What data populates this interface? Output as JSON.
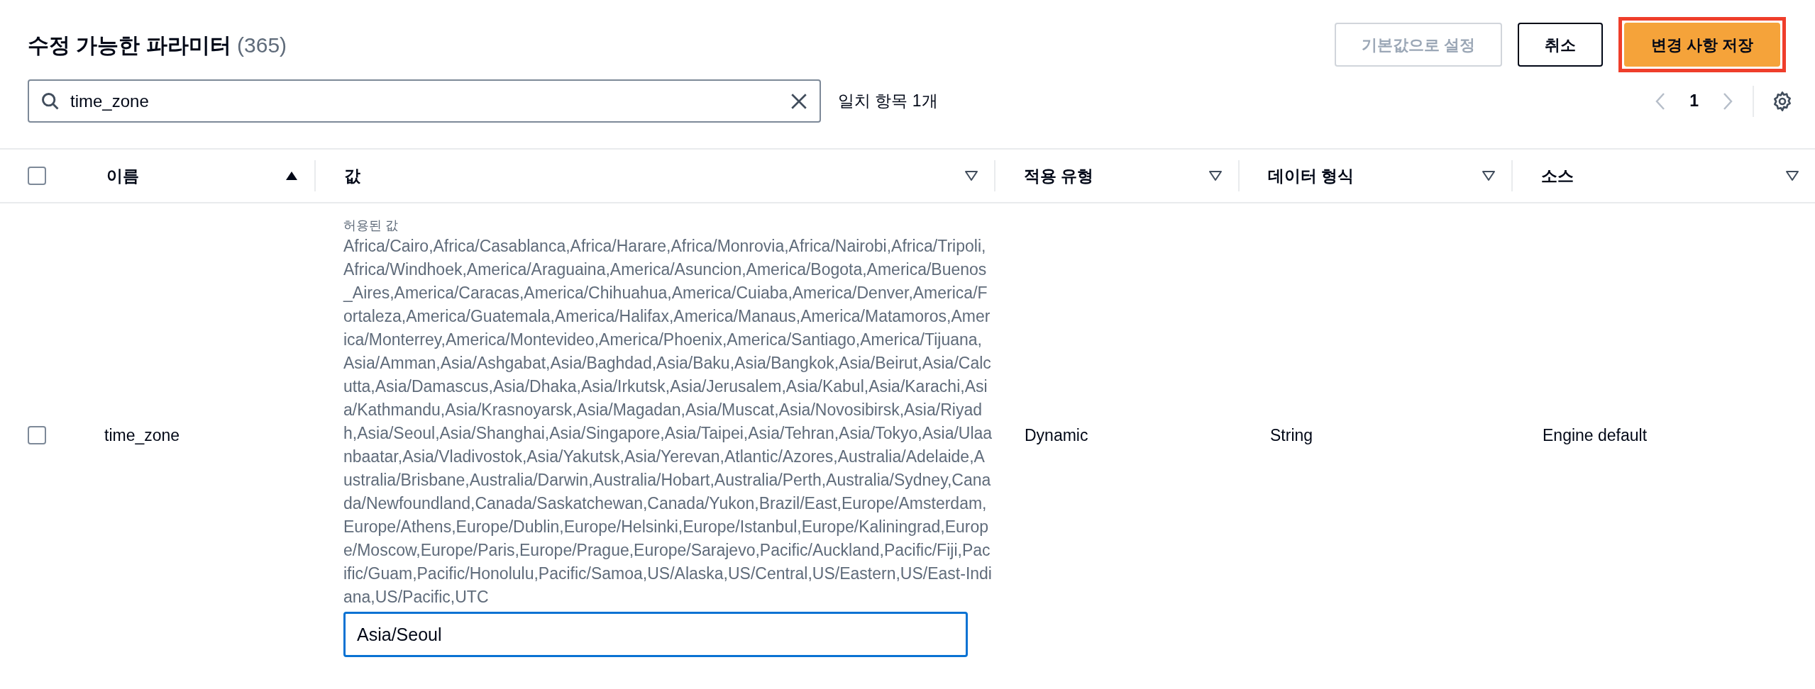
{
  "header": {
    "title": "수정 가능한 파라미터",
    "count": "(365)"
  },
  "buttons": [
    {
      "label": "기본값으로 설정",
      "kind": "normal",
      "disabled": true,
      "highlighted": false
    },
    {
      "label": "취소",
      "kind": "normal",
      "disabled": false,
      "highlighted": false
    },
    {
      "label": "변경 사항 저장",
      "kind": "primary",
      "disabled": false,
      "highlighted": true
    }
  ],
  "search": {
    "value": "time_zone",
    "match_count": "일치 항목 1개"
  },
  "pagination": {
    "page": "1",
    "previous_disabled": true,
    "next_disabled": true
  },
  "table": {
    "select_all": {
      "checked": false
    },
    "columns": [
      {
        "label": "이름",
        "sorted": true
      },
      {
        "label": "값",
        "sorted": false
      },
      {
        "label": "적용 유형",
        "sorted": false
      },
      {
        "label": "데이터 형식",
        "sorted": false
      },
      {
        "label": "소스",
        "sorted": false
      }
    ],
    "rows": [
      {
        "checked": false,
        "name": "time_zone",
        "allowed_label": "허용된 값",
        "allowed_values": "Africa/Cairo,Africa/Casablanca,Africa/Harare,Africa/Monrovia,Africa/Nairobi,Africa/Tripoli,Africa/Windhoek,America/Araguaina,America/Asuncion,America/Bogota,America/Buenos_Aires,America/Caracas,America/Chihuahua,America/Cuiaba,America/Denver,America/Fortaleza,America/Guatemala,America/Halifax,America/Manaus,America/Matamoros,America/Monterrey,America/Montevideo,America/Phoenix,America/Santiago,America/Tijuana,Asia/Amman,Asia/Ashgabat,Asia/Baghdad,Asia/Baku,Asia/Bangkok,Asia/Beirut,Asia/Calcutta,Asia/Damascus,Asia/Dhaka,Asia/Irkutsk,Asia/Jerusalem,Asia/Kabul,Asia/Karachi,Asia/Kathmandu,Asia/Krasnoyarsk,Asia/Magadan,Asia/Muscat,Asia/Novosibirsk,Asia/Riyadh,Asia/Seoul,Asia/Shanghai,Asia/Singapore,Asia/Taipei,Asia/Tehran,Asia/Tokyo,Asia/Ulaanbaatar,Asia/Vladivostok,Asia/Yakutsk,Asia/Yerevan,Atlantic/Azores,Australia/Adelaide,Australia/Brisbane,Australia/Darwin,Australia/Hobart,Australia/Perth,Australia/Sydney,Canada/Newfoundland,Canada/Saskatchewan,Canada/Yukon,Brazil/East,Europe/Amsterdam,Europe/Athens,Europe/Dublin,Europe/Helsinki,Europe/Istanbul,Europe/Kaliningrad,Europe/Moscow,Europe/Paris,Europe/Prague,Europe/Sarajevo,Pacific/Auckland,Pacific/Fiji,Pacific/Guam,Pacific/Honolulu,Pacific/Samoa,US/Alaska,US/Central,US/Eastern,US/East-Indiana,US/Pacific,UTC",
        "value": "Asia/Seoul",
        "apply_type": "Dynamic",
        "data_type": "String",
        "source": "Engine default"
      }
    ]
  }
}
